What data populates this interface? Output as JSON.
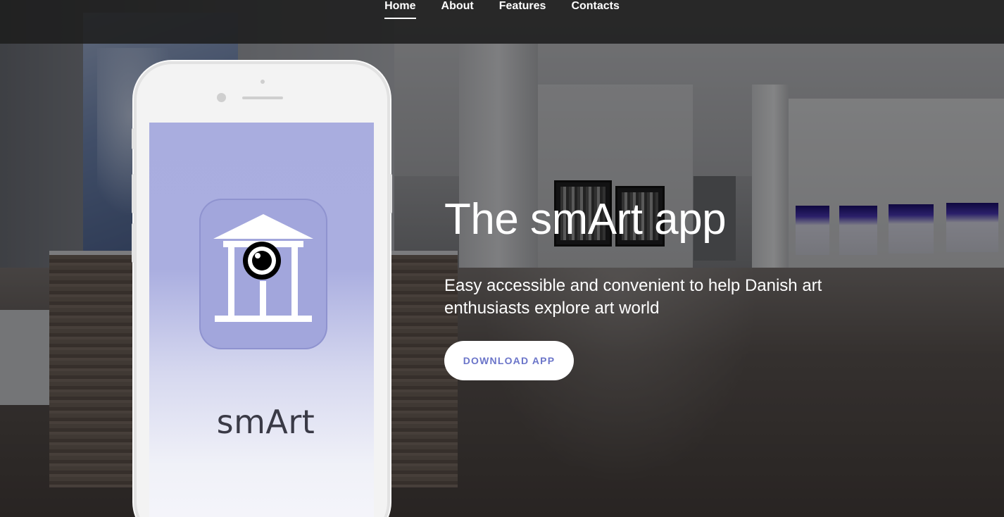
{
  "nav": {
    "items": [
      {
        "label": "Home",
        "active": true
      },
      {
        "label": "About",
        "active": false
      },
      {
        "label": "Features",
        "active": false
      },
      {
        "label": "Contacts",
        "active": false
      }
    ]
  },
  "phone": {
    "app_name": "smArt",
    "app_icon": "museum-eye-icon"
  },
  "hero": {
    "title": "The smArt app",
    "subtitle": "Easy accessible and convenient to help Danish art enthusiasts explore art world",
    "cta_label": "DOWNLOAD APP"
  },
  "colors": {
    "accent": "#6b75c9",
    "icon_bg": "#a2a6dc",
    "navbar_bg": "#1e1e1e"
  }
}
